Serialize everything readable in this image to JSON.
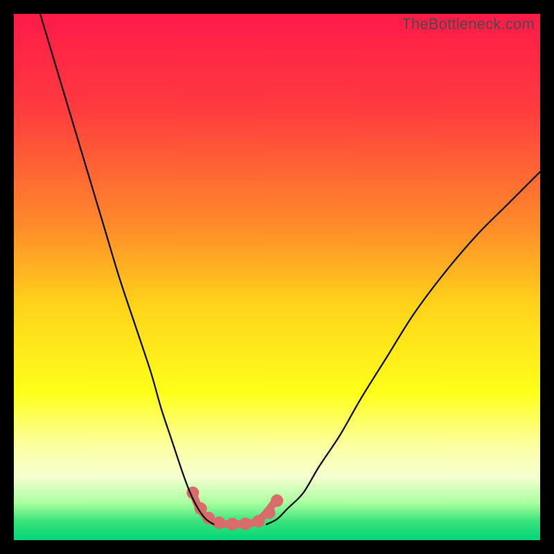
{
  "watermark": "TheBottleneck.com",
  "chart_data": {
    "type": "line",
    "title": "",
    "xlabel": "",
    "ylabel": "",
    "xlim": [
      0,
      100
    ],
    "ylim": [
      0,
      100
    ],
    "gradient_stops": [
      {
        "offset": 0.0,
        "color": "#ff1a49"
      },
      {
        "offset": 0.18,
        "color": "#ff3b3f"
      },
      {
        "offset": 0.4,
        "color": "#ff8a2a"
      },
      {
        "offset": 0.55,
        "color": "#ffd21a"
      },
      {
        "offset": 0.72,
        "color": "#ffff1a"
      },
      {
        "offset": 0.82,
        "color": "#fcffa0"
      },
      {
        "offset": 0.88,
        "color": "#f5ffd0"
      },
      {
        "offset": 0.93,
        "color": "#a8ff9e"
      },
      {
        "offset": 0.965,
        "color": "#38e27a"
      },
      {
        "offset": 1.0,
        "color": "#00d67a"
      }
    ],
    "series": [
      {
        "name": "left-branch",
        "x": [
          5,
          8,
          11,
          14,
          17,
          20,
          23,
          26,
          28,
          30,
          32,
          33.5,
          35,
          36.5,
          38
        ],
        "y": [
          100,
          90,
          80,
          70,
          60,
          50,
          41,
          32,
          25,
          19,
          13,
          9,
          6,
          4,
          3
        ]
      },
      {
        "name": "right-branch",
        "x": [
          48,
          50,
          52,
          55,
          58,
          62,
          66,
          71,
          76,
          82,
          88,
          94,
          100
        ],
        "y": [
          3,
          4,
          6,
          9,
          14,
          20,
          27,
          35,
          43,
          51,
          58,
          64,
          70
        ]
      },
      {
        "name": "trough-highlight",
        "x": [
          34,
          35,
          36,
          37,
          38,
          39,
          40,
          41,
          42,
          43,
          44,
          45,
          46,
          47,
          48,
          49,
          50
        ],
        "y": [
          9,
          6.5,
          5,
          4,
          3.4,
          3.2,
          3.1,
          3.05,
          3.0,
          3.05,
          3.1,
          3.2,
          3.5,
          4.2,
          5.2,
          6.5,
          8
        ]
      }
    ],
    "trough_points": [
      {
        "x": 34.0,
        "y": 9.0
      },
      {
        "x": 35.5,
        "y": 6.0
      },
      {
        "x": 37.0,
        "y": 4.2
      },
      {
        "x": 39.0,
        "y": 3.3
      },
      {
        "x": 41.5,
        "y": 3.05
      },
      {
        "x": 44.0,
        "y": 3.1
      },
      {
        "x": 46.5,
        "y": 3.6
      },
      {
        "x": 48.5,
        "y": 5.2
      },
      {
        "x": 50.0,
        "y": 7.5
      }
    ],
    "styles": {
      "curve_color": "#000000",
      "curve_width": 2.2,
      "trough_color": "#d96b6b",
      "trough_width": 11,
      "trough_point_radius": 9
    }
  }
}
